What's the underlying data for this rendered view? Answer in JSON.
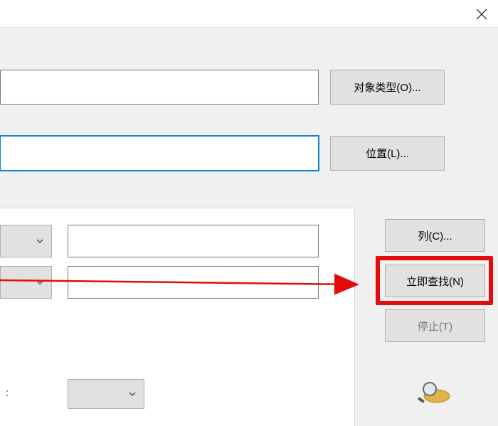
{
  "titlebar": {
    "close_name": "close-icon"
  },
  "section1": {
    "input_value": "",
    "button_label": "对象类型(O)..."
  },
  "section2": {
    "input_value": "",
    "button_label": "位置(L)..."
  },
  "filters": {
    "dropdown1_value": "",
    "dropdown2_value": "",
    "text1_value": "",
    "text2_value": "",
    "colon": ":",
    "dropdown3_value": ""
  },
  "right_buttons": {
    "columns": "列(C)...",
    "find_now": "立即查找(N)",
    "stop": "停止(T)"
  },
  "colors": {
    "highlight": "#e30b0b",
    "focus_border": "#0a84d6",
    "button_bg": "#e1e1e1",
    "disabled_text": "#7a7a7a"
  }
}
